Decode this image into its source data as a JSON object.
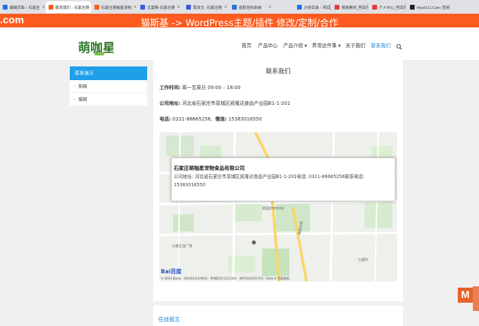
{
  "browser": {
    "tabs": [
      {
        "label": "编辑页面 ‹ 石家庄",
        "color": "#1a73e8"
      },
      {
        "label": "联系我们 - 石家庄萌",
        "color": "#fd5b1f",
        "active": true
      },
      {
        "label": "石家庄萌咖星宠物",
        "color": "#fd5b1f"
      },
      {
        "label": "尤莫斯-石家庄萌",
        "color": "#3b5bdb"
      },
      {
        "label": "首发文: 石家庄萌",
        "color": "#3b5bdb"
      },
      {
        "label": "拾取坐标系统",
        "color": "#2b6fd8"
      },
      {
        "label": "分类目录 ‹ 阿百传",
        "color": "#1a73e8"
      },
      {
        "label": "视频素材_阿百传媒",
        "color": "#e23b3b"
      },
      {
        "label": "个人中心_阿百传媒",
        "color": "#e23b3b"
      },
      {
        "label": "HostCLI.Com 官网",
        "color": "#222222"
      }
    ]
  },
  "banner": {
    "left": ".com",
    "center": "猫斯基 -> WordPress主题/插件 修改/定制/合作"
  },
  "header": {
    "logo_text": "萌咖星",
    "nav": [
      {
        "label": "首页"
      },
      {
        "label": "产品中心"
      },
      {
        "label": "产品介绍 ▾"
      },
      {
        "label": "养宠这件事 ▾"
      },
      {
        "label": "关于我们"
      },
      {
        "label": "联系我们",
        "active": true
      }
    ]
  },
  "sidebar": {
    "title": "菜单演示",
    "items": [
      {
        "label": "狗粮"
      },
      {
        "label": "猫粮"
      }
    ]
  },
  "main": {
    "title": "联系我们",
    "hours_label": "工作时间:",
    "hours_value": " 周一至周日 09:00 – 18:00",
    "address_label": "公司地址:",
    "address_value": " 河北省石家庄市栾城区凯隆达食品产业园B1-1-201",
    "phone_label": "电话:",
    "phone_value": " 0311-88665256,",
    "wechat_label": "微信:",
    "wechat_value": " 15383016550"
  },
  "map": {
    "popup_title": "石家庄萌咖星宠物食品有限公司",
    "popup_body": "公司地址: 河北省石家庄市栾城区凯隆达食品产业园B1-1-201电话: 0311-88665256联系电话: 15383016550",
    "labels": {
      "station": "翠园STATION",
      "plaza": "九曜生活广场",
      "road": "裕翔大街",
      "village": "七曜村",
      "copyright": "© 2024 Baidu - GS(2023)3206号 - 甲测资字11111342 - 京ICP证030173号 - Data © 百度智图",
      "baidu": "Bai百度"
    }
  },
  "bottom": {
    "title": "在线留言"
  },
  "watermark": {
    "letter": "M"
  }
}
